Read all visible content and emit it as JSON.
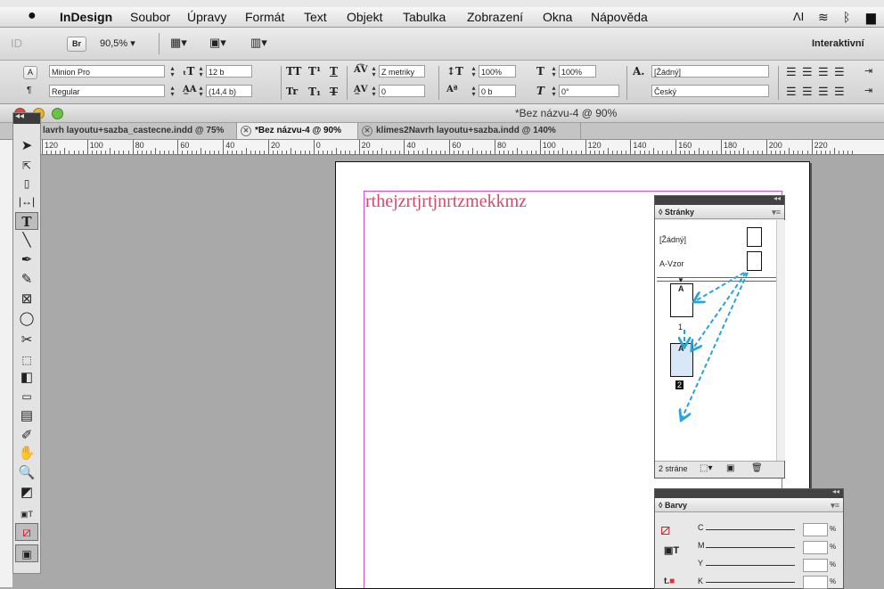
{
  "menubar": {
    "apple_icon": "apple-icon",
    "app_name": "InDesign",
    "items": [
      "Soubor",
      "Úpravy",
      "Formát",
      "Text",
      "Objekt",
      "Tabulka",
      "Zobrazení",
      "Okna",
      "Nápověda"
    ]
  },
  "appbar": {
    "zoom": "90,5%",
    "workspace": "Interaktivní",
    "br_label": "Br",
    "id_label": "ID"
  },
  "control": {
    "font_family": "Minion Pro",
    "font_style": "Regular",
    "font_size": "12 b",
    "leading": "(14,4 b)",
    "kerning": "Z metriky",
    "tracking": "0",
    "vertical_scale": "100%",
    "horizontal_scale": "100%",
    "baseline_shift": "0 b",
    "skew": "0°",
    "char_style": "[Žádný]",
    "language": "Český"
  },
  "window": {
    "title": "*Bez názvu-4 @ 90%",
    "tabs": [
      {
        "label": "lavrh layoutu+sazba_castecne.indd @ 75%",
        "active": false
      },
      {
        "label": "*Bez názvu-4 @ 90%",
        "active": true
      },
      {
        "label": "klimes2Navrh layoutu+sazba.indd @ 140%",
        "active": false
      }
    ]
  },
  "ruler": {
    "labels": [
      "120",
      "100",
      "80",
      "60",
      "40",
      "20",
      "0",
      "20",
      "40",
      "60",
      "80",
      "100",
      "120",
      "140",
      "160",
      "180",
      "200",
      "220"
    ]
  },
  "document": {
    "text": "rthejzrtjrtjnrtzmekkmz",
    "text_color": "#d8476a",
    "margin_color": "#d04dd4"
  },
  "pages_panel": {
    "title": "◊ Stránky",
    "masters": [
      "[Žádný]",
      "A-Vzor"
    ],
    "pages": [
      {
        "number": "1",
        "master_prefix": "A",
        "selected": false
      },
      {
        "number": "2",
        "master_prefix": "A",
        "selected": true
      }
    ],
    "footer": "2 stráne"
  },
  "swatches_panel": {
    "title": "◊ Barvy",
    "channels": [
      "C",
      "M",
      "Y",
      "K"
    ],
    "unit": "%"
  },
  "colors": {
    "arrow": "#29a3dc",
    "page_selected_fill": "#d8e8f6"
  }
}
